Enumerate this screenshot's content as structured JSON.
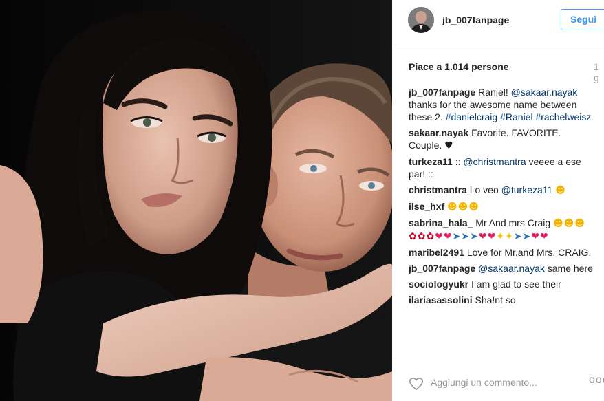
{
  "post": {
    "username": "jb_007fanpage",
    "follow_label": "Segui",
    "likes": "Piace a 1.014 persone",
    "time": "1 g"
  },
  "comments": [
    {
      "user": "jb_007fanpage",
      "parts": [
        {
          "t": "text",
          "v": " Raniel! "
        },
        {
          "t": "mention",
          "v": "@sakaar.nayak"
        },
        {
          "t": "text",
          "v": " thanks for the awesome name between these 2. "
        },
        {
          "t": "tag",
          "v": "#danielcraig"
        },
        {
          "t": "text",
          "v": " "
        },
        {
          "t": "tag",
          "v": "#Raniel"
        },
        {
          "t": "text",
          "v": " "
        },
        {
          "t": "tag",
          "v": "#rachelweisz"
        }
      ]
    },
    {
      "user": "sakaar.nayak",
      "parts": [
        {
          "t": "text",
          "v": " Favorite. FAVORITE. Couple. "
        },
        {
          "t": "emoji",
          "v": "♥",
          "c": "e-black"
        }
      ]
    },
    {
      "user": "turkeza11",
      "parts": [
        {
          "t": "text",
          "v": " :: "
        },
        {
          "t": "mention",
          "v": "@christmantra"
        },
        {
          "t": "text",
          "v": " veeee a ese par! ::"
        }
      ]
    },
    {
      "user": "christmantra",
      "parts": [
        {
          "t": "text",
          "v": " Lo veo "
        },
        {
          "t": "mention",
          "v": "@turkeza11"
        },
        {
          "t": "text",
          "v": " "
        },
        {
          "t": "emoji",
          "v": "☻",
          "c": "e-face"
        }
      ]
    },
    {
      "user": "ilse_hxf",
      "parts": [
        {
          "t": "text",
          "v": " "
        },
        {
          "t": "emoji",
          "v": "☻☻☻",
          "c": "e-face"
        }
      ]
    },
    {
      "user": "sabrina_hala_",
      "parts": [
        {
          "t": "text",
          "v": " Mr And mrs Craig "
        },
        {
          "t": "emoji",
          "v": "☻☻☻",
          "c": "e-face"
        },
        {
          "t": "emoji",
          "v": "✿✿✿",
          "c": "e-rose"
        },
        {
          "t": "emoji",
          "v": "❤❤",
          "c": "e-red"
        },
        {
          "t": "emoji",
          "v": "➤➤➤",
          "c": "e-car"
        },
        {
          "t": "emoji",
          "v": "❤❤",
          "c": "e-red"
        },
        {
          "t": "emoji",
          "v": "✦✦",
          "c": "e-spark"
        },
        {
          "t": "emoji",
          "v": "➤➤",
          "c": "e-car"
        },
        {
          "t": "emoji",
          "v": "❤❤",
          "c": "e-red"
        }
      ]
    },
    {
      "user": "maribel2491",
      "parts": [
        {
          "t": "text",
          "v": " Love for Mr.and Mrs. CRAIG."
        }
      ]
    },
    {
      "user": "jb_007fanpage",
      "parts": [
        {
          "t": "text",
          "v": " "
        },
        {
          "t": "mention",
          "v": "@sakaar.nayak"
        },
        {
          "t": "text",
          "v": " same here"
        }
      ]
    },
    {
      "user": "sociologyukr",
      "parts": [
        {
          "t": "text",
          "v": " I am glad to see their"
        }
      ]
    },
    {
      "user": "ilariasassolini",
      "parts": [
        {
          "t": "text",
          "v": " Sha!nt so"
        }
      ]
    }
  ],
  "footer": {
    "comment_placeholder": "Aggiungi un commento...",
    "more_label": "ooo"
  },
  "icons": {
    "like": "heart-outline-icon",
    "more": "more-options-icon"
  },
  "colors": {
    "accent": "#3897f0",
    "link": "#003569",
    "muted": "#999999",
    "text": "#262626"
  }
}
